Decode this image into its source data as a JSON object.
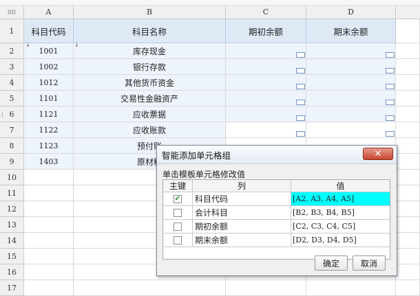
{
  "columns": [
    "A",
    "B",
    "C",
    "D"
  ],
  "row_numbers": [
    "1",
    "2",
    "3",
    "4",
    "5",
    "6",
    "7",
    "8",
    "9",
    "10",
    "11",
    "12",
    "13",
    "14",
    "15",
    "16",
    "17"
  ],
  "header_row": [
    "科目代码",
    "科目名称",
    "期初余额",
    "期末余额"
  ],
  "rows": [
    {
      "code": "1001",
      "name": "库存现金"
    },
    {
      "code": "1002",
      "name": "银行存款"
    },
    {
      "code": "1012",
      "name": "其他货币资金"
    },
    {
      "code": "1101",
      "name": "交易性金融资产"
    },
    {
      "code": "1121",
      "name": "应收票据"
    },
    {
      "code": "1122",
      "name": "应收账款"
    },
    {
      "code": "1123",
      "name": "预付账"
    },
    {
      "code": "1403",
      "name": "原材料"
    }
  ],
  "dialog": {
    "title": "智能添加单元格组",
    "close_label": "✕",
    "group_label": "单击模板单元格修改值",
    "headers": [
      "主键",
      "列",
      "值"
    ],
    "items": [
      {
        "checked": true,
        "column": "科目代码",
        "value": "[A2, A3, A4, A5]"
      },
      {
        "checked": false,
        "column": "会计科目",
        "value": "[B2, B3, B4, B5]"
      },
      {
        "checked": false,
        "column": "期初余额",
        "value": "[C2, C3, C4, C5]"
      },
      {
        "checked": false,
        "column": "期末余额",
        "value": "[D2, D3, D4, D5]"
      }
    ],
    "ok_label": "确定",
    "cancel_label": "取消"
  },
  "colors": {
    "header_fill": "#dfe9f6",
    "active_value": "#00ffff",
    "close_button": "#c9462e"
  }
}
